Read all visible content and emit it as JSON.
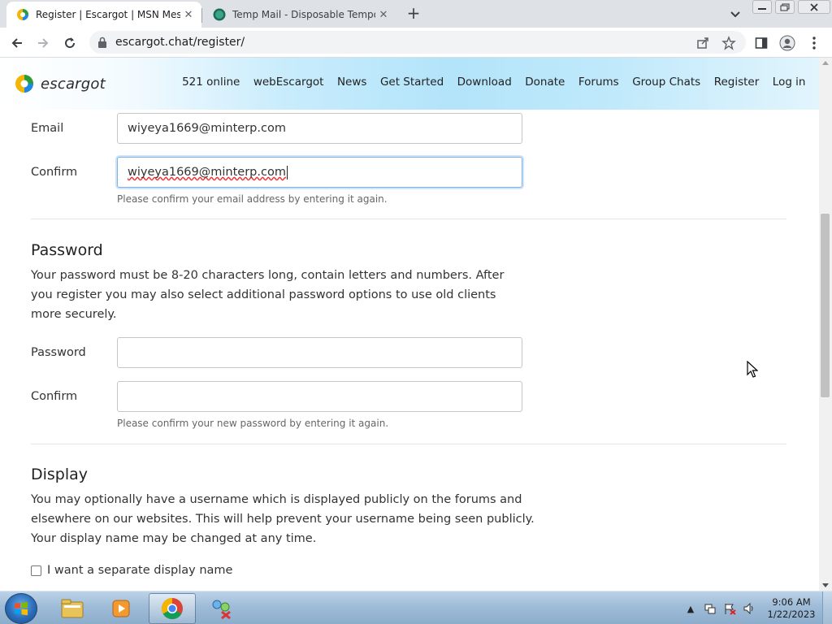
{
  "browser": {
    "tabs": [
      {
        "title": "Register | Escargot | MSN Messe",
        "active": true
      },
      {
        "title": "Temp Mail - Disposable Tempora",
        "active": false
      }
    ],
    "url": "escargot.chat/register/"
  },
  "site": {
    "logo_text": "escargot",
    "nav": [
      "521 online",
      "webEscargot",
      "News",
      "Get Started",
      "Download",
      "Donate",
      "Forums",
      "Group Chats",
      "Register",
      "Log in"
    ]
  },
  "form": {
    "email_label": "Email",
    "email_value": "wiyeya1669@minterp.com",
    "confirm_email_label": "Confirm",
    "confirm_email_value": "wiyeya1669@minterp.com",
    "confirm_email_help": "Please confirm your email address by entering it again.",
    "password_heading": "Password",
    "password_desc": "Your password must be 8-20 characters long, contain letters and numbers. After you register you may also select additional password options to use old clients more securely.",
    "password_label": "Password",
    "password_value": "",
    "confirm_password_label": "Confirm",
    "confirm_password_value": "",
    "confirm_password_help": "Please confirm your new password by entering it again.",
    "display_heading": "Display",
    "display_desc": "You may optionally have a username which is displayed publicly on the forums and elsewhere on our websites. This will help prevent your username being seen publicly. Your display name may be changed at any time.",
    "display_checkbox_label": "I want a separate display name",
    "display_checkbox_checked": false
  },
  "taskbar": {
    "time": "9:06 AM",
    "date": "1/22/2023"
  },
  "colors": {
    "focus_border": "#7fb2e5",
    "header_gradient": "#b3e4fa"
  }
}
